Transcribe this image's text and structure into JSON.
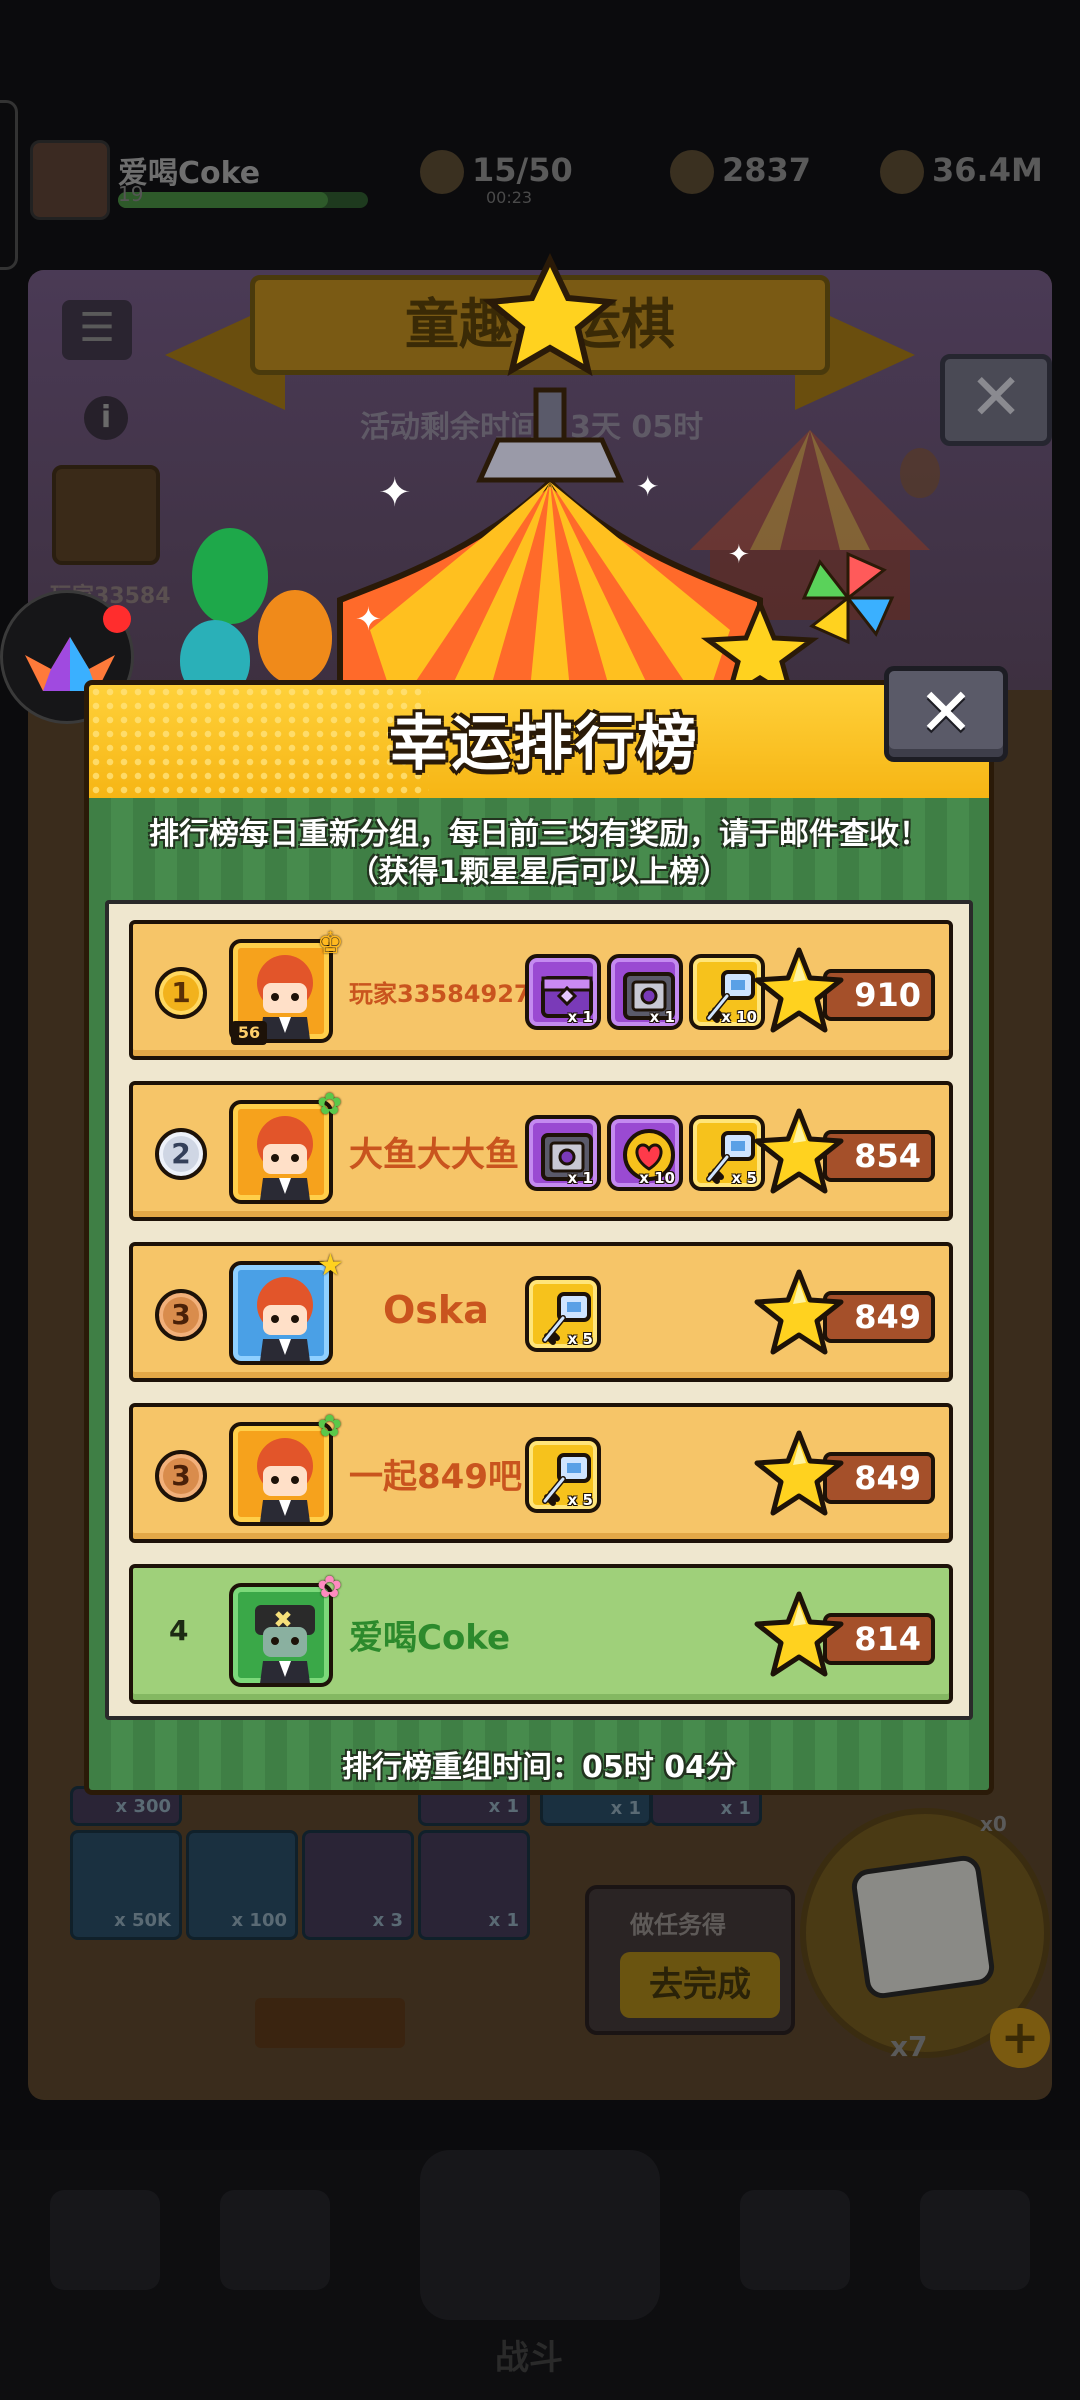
{
  "hud": {
    "player_name": "爱喝Coke",
    "level": "19",
    "energy": "15/50",
    "energy_timer": "00:23",
    "gems": "2837",
    "coins": "36.4M"
  },
  "event": {
    "title": "童趣幸运棋",
    "remaining": "活动剩余时间：3天 05时",
    "my_rank_label": "玩家33584",
    "my_level": "56"
  },
  "board": {
    "cells": [
      {
        "qty": "x 300"
      },
      {
        "qty": "x 1"
      },
      {
        "qty": "x 1"
      },
      {
        "qty": "x 1"
      },
      {
        "qty": "x 50K"
      },
      {
        "qty": "x 100"
      },
      {
        "qty": "x 3"
      },
      {
        "qty": "x 1"
      }
    ],
    "task_label": "做任务得",
    "task_button": "去完成",
    "dice_count": "x7",
    "dice_extra": "x0",
    "nav_battle": "战斗"
  },
  "dialog": {
    "title": "幸运排行榜",
    "notice_line1": "排行榜每日重新分组，每日前三均有奖励，请于邮件查收！",
    "notice_line2": "（获得1颗星星后可以上榜）",
    "reset_time": "排行榜重组时间：05时 04分",
    "close_icon": "close-icon"
  },
  "leaderboard": [
    {
      "rank": "1",
      "badge": "gold",
      "name": "玩家33584927",
      "level": "56",
      "avatar_color": "orange",
      "rewards": [
        {
          "icon": "chest-purple-icon",
          "qty": "x 1",
          "color": "purple"
        },
        {
          "icon": "safe-purple-icon",
          "qty": "x 1",
          "color": "purple"
        },
        {
          "icon": "key-icon",
          "qty": "x 10",
          "color": "yellow"
        }
      ],
      "stars": "910"
    },
    {
      "rank": "2",
      "badge": "silver",
      "name": "大鱼大大鱼",
      "avatar_color": "orange",
      "rewards": [
        {
          "icon": "safe-purple-icon",
          "qty": "x 1",
          "color": "purple"
        },
        {
          "icon": "heart-icon",
          "qty": "x 10",
          "color": "purple"
        },
        {
          "icon": "key-icon",
          "qty": "x 5",
          "color": "yellow"
        }
      ],
      "stars": "854"
    },
    {
      "rank": "3",
      "badge": "bronze",
      "name": "Oska",
      "avatar_color": "blue",
      "rewards": [
        {
          "icon": "key-icon",
          "qty": "x 5",
          "color": "yellow"
        }
      ],
      "stars": "849"
    },
    {
      "rank": "3",
      "badge": "bronze",
      "name": "一起849吧",
      "avatar_color": "orange",
      "rewards": [
        {
          "icon": "key-icon",
          "qty": "x 5",
          "color": "yellow"
        }
      ],
      "stars": "849"
    },
    {
      "rank": "4",
      "badge": "none",
      "name": "爱喝Coke",
      "avatar_color": "green",
      "is_me": true,
      "rewards": [],
      "stars": "814"
    }
  ],
  "colors": {
    "row_default": "#f6c568",
    "row_me": "#9fd07a",
    "name_default": "#c9541e",
    "name_me": "#2c8a2c",
    "score_pill": "#a5502a",
    "dialog_header": "#f6b514",
    "dialog_body": "#478b4d"
  }
}
